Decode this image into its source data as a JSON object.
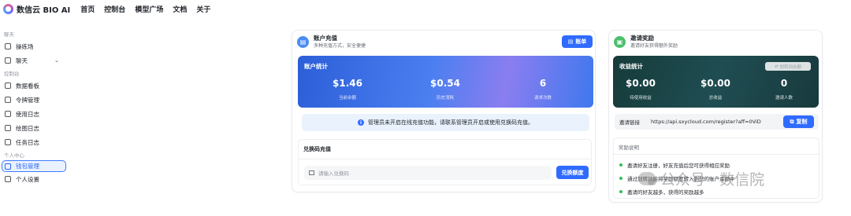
{
  "topnav": {
    "brand": "数信云 BIO AI",
    "links": [
      "首页",
      "控制台",
      "模型广场",
      "文档",
      "关于"
    ]
  },
  "sidebar": {
    "sections": [
      {
        "title": "聊天",
        "items": [
          {
            "label": "操练场",
            "icon": "playground-icon"
          },
          {
            "label": "聊天",
            "icon": "chat-icon"
          }
        ]
      },
      {
        "title": "控制台",
        "items": [
          {
            "label": "数据看板",
            "icon": "dashboard-icon"
          },
          {
            "label": "令牌管理",
            "icon": "key-icon"
          },
          {
            "label": "使用日志",
            "icon": "bar-chart-icon"
          },
          {
            "label": "绘图日志",
            "icon": "image-icon"
          },
          {
            "label": "任务日志",
            "icon": "task-icon"
          }
        ]
      },
      {
        "title": "个人中心",
        "items": [
          {
            "label": "钱包管理",
            "icon": "wallet-icon",
            "active": true
          },
          {
            "label": "个人设置",
            "icon": "user-icon"
          }
        ]
      }
    ]
  },
  "recharge": {
    "title": "账户充值",
    "subtitle": "多种充值方式，安全便捷",
    "bill_button": "账单",
    "stats_title": "账户统计",
    "stats": [
      {
        "value": "$1.46",
        "label": "当前余额"
      },
      {
        "value": "$0.54",
        "label": "历史消耗"
      },
      {
        "value": "6",
        "label": "请求次数"
      }
    ],
    "notice": "管理员未开启在线充值功能，请联系管理员开启或使用兑换码充值。",
    "redeem_title": "兑换码充值",
    "redeem_placeholder": "请输入兑换码",
    "redeem_button": "兑换额度"
  },
  "invite": {
    "title": "邀请奖励",
    "subtitle": "邀请好友获得额外奖励",
    "stats_title": "收益统计",
    "transfer_button": "划转到余额",
    "stats": [
      {
        "value": "$0.00",
        "label": "待使用收益"
      },
      {
        "value": "$0.00",
        "label": "总收益"
      },
      {
        "value": "0",
        "label": "邀请人数"
      }
    ],
    "link_label": "邀请链接",
    "link_value": "https://api.sxycloud.com/register?aff=0ViD",
    "copy_button": "复制",
    "rules_title": "奖励说明",
    "rules": [
      "邀请好友注册，好友充值后您可获得相应奖励",
      "通过划转功能将奖励额度转入到您的账户余额中",
      "邀请的好友越多，获得的奖励越多"
    ]
  },
  "watermark": "公众号 · 数信院",
  "colors": {
    "primary": "#2f6bff",
    "success": "#2fbf56",
    "dark_panel": "#1f4d52"
  }
}
